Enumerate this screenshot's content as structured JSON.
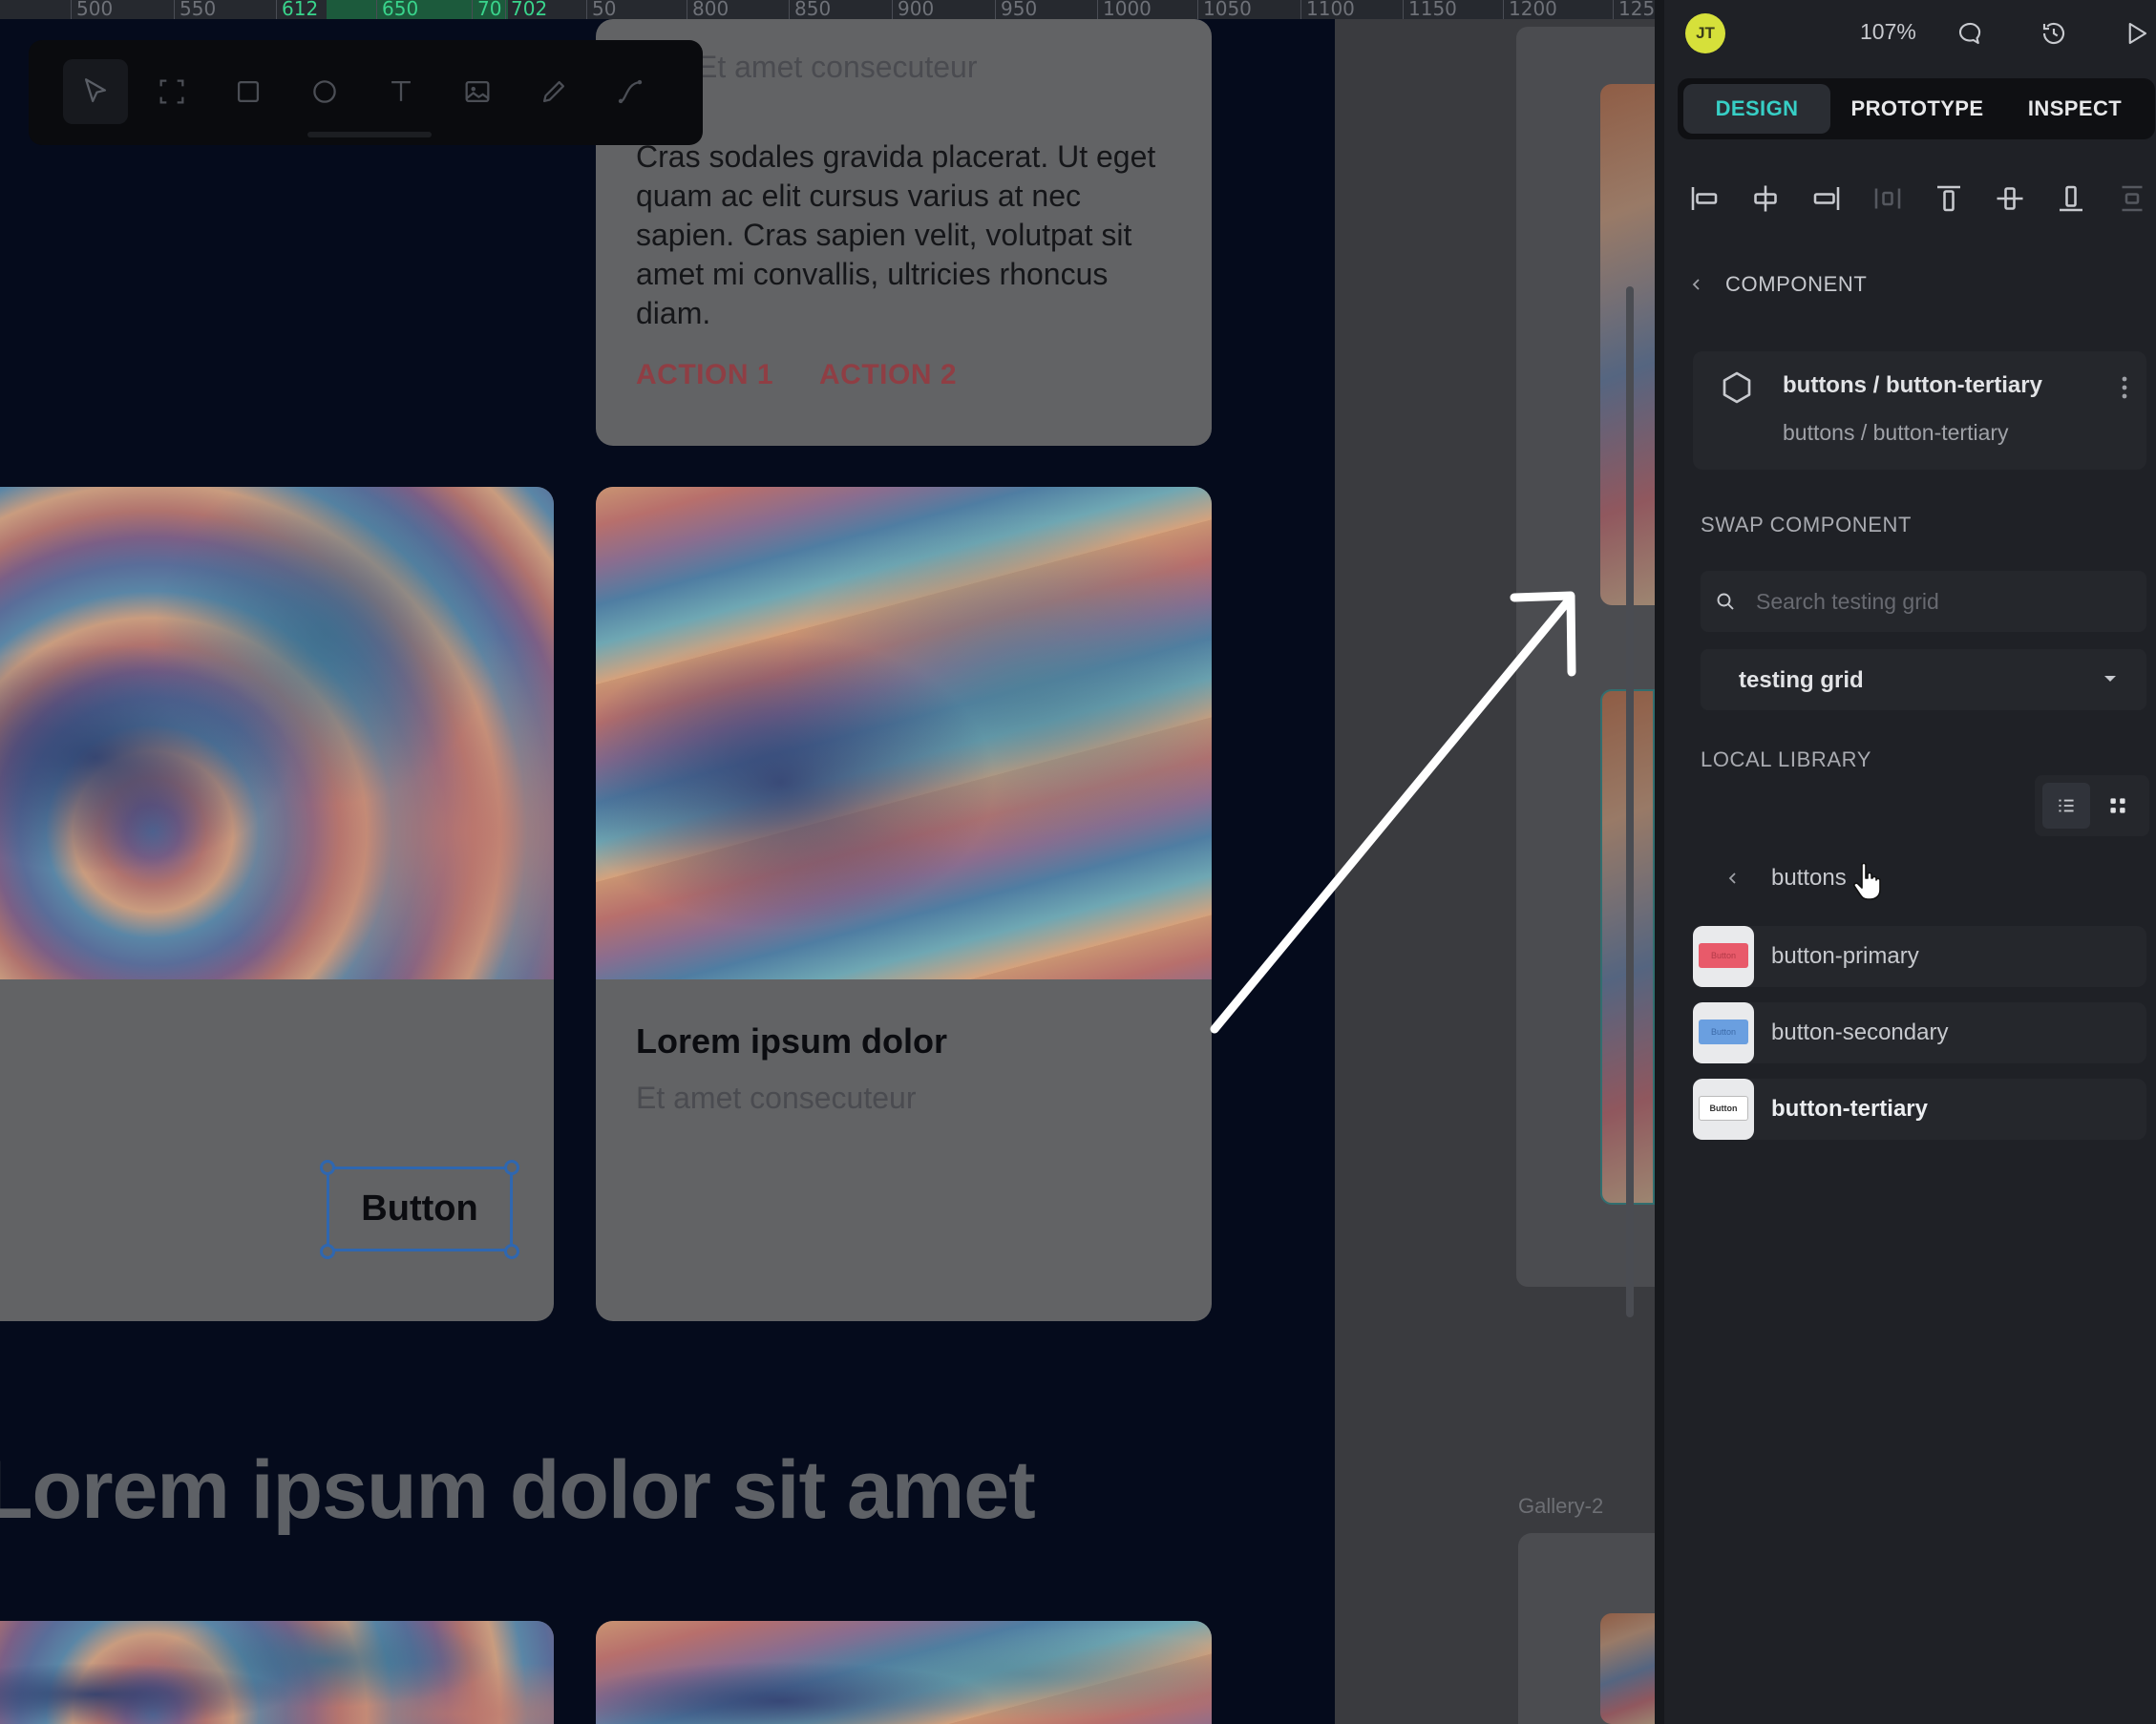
{
  "ruler": {
    "labels": [
      "500",
      "550",
      "612",
      "650",
      "70",
      "702",
      "50",
      "800",
      "850",
      "900",
      "950",
      "1000",
      "1050",
      "1100",
      "1150",
      "1200",
      "125"
    ]
  },
  "canvas": {
    "top_card": {
      "subtitle": "Et amet consecuteur",
      "body": "Cras sodales gravida placerat. Ut eget quam ac elit cursus varius at nec sapien. Cras sapien velit, volutpat sit amet mi convallis, ultricies rhoncus diam.",
      "action1": "ACTION 1",
      "action2": "ACTION 2"
    },
    "left_card": {
      "button_label": "Button"
    },
    "right_card": {
      "title": "Lorem ipsum dolor",
      "subtitle": "Et amet consecuteur"
    },
    "heading": "Lorem ipsum dolor sit amet",
    "gallery_label": "Gallery-2"
  },
  "toolbar": {
    "tools": [
      "select-tool",
      "frame-tool",
      "rectangle-tool",
      "ellipse-tool",
      "text-tool",
      "image-tool",
      "pencil-tool",
      "path-tool"
    ],
    "active": "select-tool"
  },
  "panel": {
    "avatar_initials": "JT",
    "zoom": "107%",
    "tabs": [
      "DESIGN",
      "PROTOTYPE",
      "INSPECT"
    ],
    "active_tab": "DESIGN",
    "component_section": "COMPONENT",
    "component": {
      "title": "buttons / button-tertiary",
      "subtitle": "buttons / button-tertiary"
    },
    "swap_section": "SWAP COMPONENT",
    "search_placeholder": "Search testing grid",
    "library_select": "testing grid",
    "local_library": "LOCAL LIBRARY",
    "folder": "buttons",
    "items": [
      {
        "name": "button-primary",
        "thumb_color": "#e85a6a",
        "thumb_text": "Button"
      },
      {
        "name": "button-secondary",
        "thumb_color": "#6a9fe0",
        "thumb_text": "Button"
      },
      {
        "name": "button-tertiary",
        "thumb_color": "#ffffff",
        "thumb_text": "Button"
      }
    ],
    "colors": {
      "accent": "#37cfc6",
      "avatar": "#d6e03a",
      "panel_bg": "#1f2126"
    }
  }
}
